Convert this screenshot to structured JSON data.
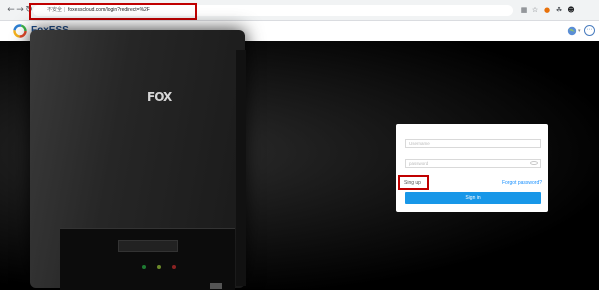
{
  "browser": {
    "back_icon": "arrow-left",
    "forward_icon": "arrow-right",
    "reload_icon": "reload",
    "security_label": "不安全",
    "url_separator": "|",
    "url": "foxesscloud.com/login?redirect=%2F",
    "toolbar_icons": [
      "translate-icon",
      "star-icon",
      "extension-icon",
      "puzzle-icon",
      "account-icon"
    ]
  },
  "header": {
    "brand": "FoxESS",
    "language_icon": "globe-icon",
    "menu_icon": "more-icon"
  },
  "hero": {
    "inverter_logo": "FOX"
  },
  "login": {
    "username_placeholder": "Username",
    "password_placeholder": "password",
    "signup_label": "Sing up",
    "forgot_label": "Forgot password?",
    "signin_label": "Sign in"
  },
  "colors": {
    "highlight": "#c00000",
    "accent": "#1897e8",
    "brand": "#1f4e8c",
    "link": "#1890ff"
  }
}
